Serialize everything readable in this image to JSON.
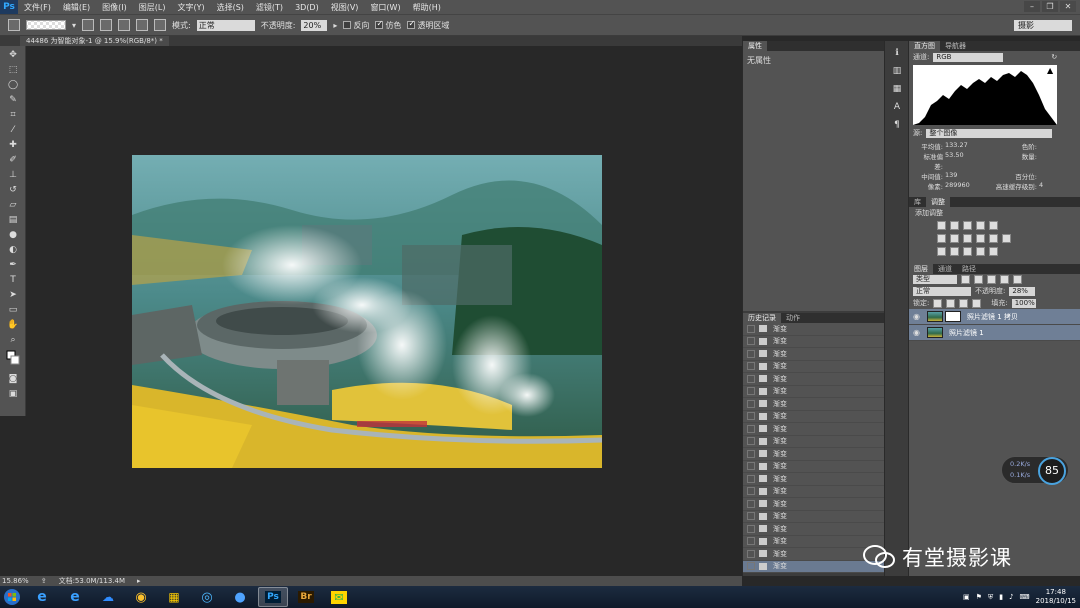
{
  "menubar": {
    "logo": "Ps",
    "items": [
      "文件(F)",
      "编辑(E)",
      "图像(I)",
      "图层(L)",
      "文字(Y)",
      "选择(S)",
      "滤镜(T)",
      "3D(D)",
      "视图(V)",
      "窗口(W)",
      "帮助(H)"
    ]
  },
  "optionsbar": {
    "mode_label": "模式:",
    "mode_value": "正常",
    "opacity_label": "不透明度:",
    "opacity_value": "20%",
    "reverse_label": "反向",
    "dither_label": "仿色",
    "transparency_label": "透明区域",
    "workspace": "摄影"
  },
  "document": {
    "tab_title": "44486 为智能对象-1 @ 15.9%(RGB/8*) *",
    "zoom": "15.86%",
    "doc_size": "文档:53.0M/113.4M"
  },
  "properties": {
    "tab": "属性",
    "empty_text": "无属性"
  },
  "history": {
    "tabs": [
      "历史记录",
      "动作"
    ],
    "entries": [
      "渐变",
      "渐变",
      "渐变",
      "渐变",
      "渐变",
      "渐变",
      "渐变",
      "渐变",
      "渐变",
      "渐变",
      "渐变",
      "渐变",
      "渐变",
      "渐变",
      "渐变",
      "渐变",
      "渐变",
      "渐变",
      "渐变",
      "渐变"
    ]
  },
  "histogram": {
    "tabs": [
      "直方图",
      "导航器"
    ],
    "channel_label": "通道:",
    "channel_value": "RGB",
    "source_label": "源:",
    "source_value": "整个图像",
    "stats": {
      "mean_label": "平均值:",
      "mean": "133.27",
      "stddev_label": "标准偏差:",
      "stddev": "53.50",
      "median_label": "中间值:",
      "median": "139",
      "pixels_label": "像素:",
      "pixels": "289960",
      "level_label": "色阶:",
      "count_label": "数量:",
      "percentile_label": "百分位:",
      "cache_label": "高速缓存级别:",
      "cache": "4"
    }
  },
  "adjustments": {
    "tabs": [
      "库",
      "调整"
    ],
    "title": "添加调整"
  },
  "layers": {
    "tabs": [
      "图层",
      "通道",
      "路径"
    ],
    "filter_kind": "类型",
    "blend_mode": "正常",
    "opacity_label": "不透明度:",
    "opacity_value": "28%",
    "lock_label": "锁定:",
    "fill_label": "填充:",
    "fill_value": "100%",
    "items": [
      {
        "name": "照片滤镜 1 拷贝"
      },
      {
        "name": "照片滤镜 1"
      }
    ]
  },
  "netspeed": {
    "up": "0.2K/s",
    "down": "0.1K/s",
    "percent": "85"
  },
  "watermark": "有堂摄影课",
  "taskbar": {
    "time": "17:48",
    "date": "2018/10/15",
    "ps_label": "Ps",
    "br_label": "Br"
  }
}
